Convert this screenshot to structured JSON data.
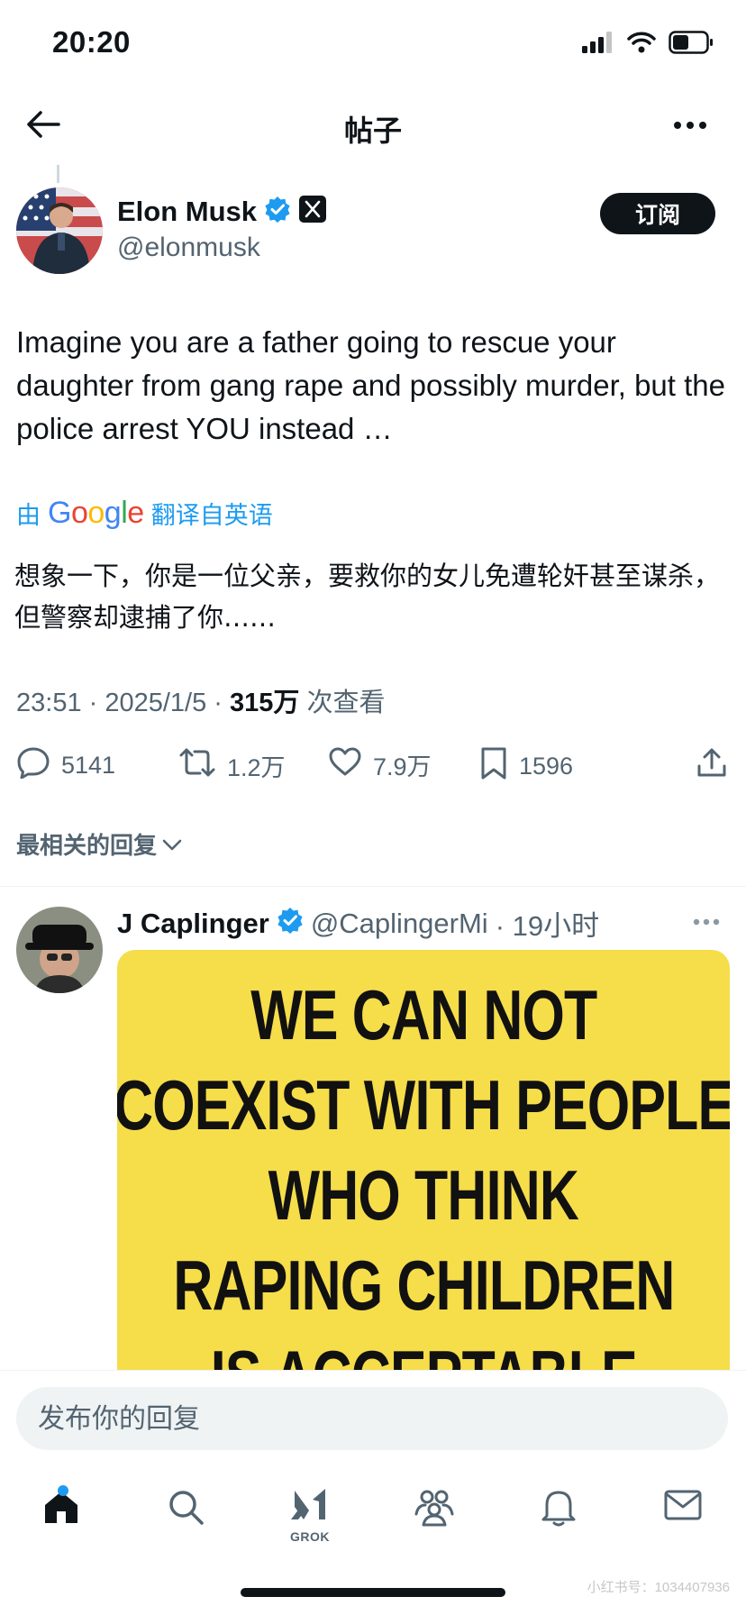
{
  "status": {
    "time": "20:20"
  },
  "nav": {
    "title": "帖子"
  },
  "author": {
    "name": "Elon Musk",
    "handle": "@elonmusk",
    "subscribe_label": "订阅"
  },
  "post": {
    "text": "Imagine you are a father going to rescue your daughter from gang rape and possibly murder, but the police arrest YOU instead …",
    "translation": {
      "prefix": "由",
      "provider": "Google",
      "suffix": "翻译自英语",
      "text": "想象一下，你是一位父亲，要救你的女儿免遭轮奸甚至谋杀，但警察却逮捕了你……"
    },
    "meta": {
      "time_date": "23:51 · 2025/1/5 · ",
      "views_count": "315万",
      "views_label": " 次查看"
    },
    "actions": {
      "replies": "5141",
      "reposts": "1.2万",
      "likes": "7.9万",
      "bookmarks": "1596"
    }
  },
  "replies_sort": {
    "label": "最相关的回复"
  },
  "reply": {
    "name": "J Caplinger",
    "handle": "@CaplingerMi",
    "time": "· 19小时",
    "media_lines": [
      "WE CAN NOT",
      "COEXIST WITH PEOPLE",
      "WHO THINK",
      "RAPING CHILDREN",
      "IS ACCEPTABLE"
    ]
  },
  "composer": {
    "placeholder": "发布你的回复"
  },
  "tabs": {
    "grok_label": "GROK",
    "icons": [
      "home-icon",
      "search-icon",
      "grok-icon",
      "communities-icon",
      "notifications-icon",
      "messages-icon"
    ]
  },
  "colors": {
    "accent": "#1d9bf0",
    "text": "#0f1419",
    "muted": "#536471",
    "meme_background": "#f6dd4a"
  },
  "watermark": "小红书号：1034407936"
}
